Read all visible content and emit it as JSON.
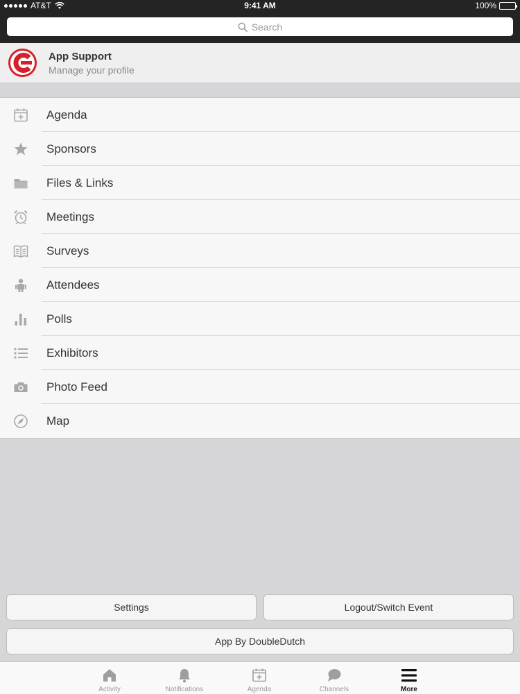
{
  "status_bar": {
    "carrier": "AT&T",
    "time": "9:41 AM",
    "battery": "100%",
    "battery_level": 1.0
  },
  "search": {
    "placeholder": "Search"
  },
  "profile": {
    "title": "App Support",
    "subtitle": "Manage your profile",
    "avatar_icon": "event-logo-icon"
  },
  "menu": {
    "items": [
      {
        "label": "Agenda",
        "icon": "calendar-plus-icon"
      },
      {
        "label": "Sponsors",
        "icon": "star-icon"
      },
      {
        "label": "Files & Links",
        "icon": "folder-icon"
      },
      {
        "label": "Meetings",
        "icon": "alarm-clock-icon"
      },
      {
        "label": "Surveys",
        "icon": "open-book-icon"
      },
      {
        "label": "Attendees",
        "icon": "people-icon"
      },
      {
        "label": "Polls",
        "icon": "bar-chart-icon"
      },
      {
        "label": "Exhibitors",
        "icon": "list-icon"
      },
      {
        "label": "Photo Feed",
        "icon": "camera-icon"
      },
      {
        "label": "Map",
        "icon": "compass-icon"
      }
    ]
  },
  "buttons": {
    "settings": "Settings",
    "logout": "Logout/Switch Event",
    "app_by": "App By DoubleDutch"
  },
  "tabbar": {
    "tabs": [
      {
        "label": "Activity",
        "icon": "home-icon"
      },
      {
        "label": "Notifications",
        "icon": "bell-icon"
      },
      {
        "label": "Agenda",
        "icon": "calendar-plus-icon"
      },
      {
        "label": "Channels",
        "icon": "chat-bubble-icon"
      },
      {
        "label": "More",
        "icon": "hamburger-menu-icon",
        "active": true
      }
    ]
  },
  "colors": {
    "header_bg": "#242424",
    "page_bg": "#d6d6d8",
    "icon_gray": "#a8a8a8",
    "logo_red": "#d4202a"
  }
}
